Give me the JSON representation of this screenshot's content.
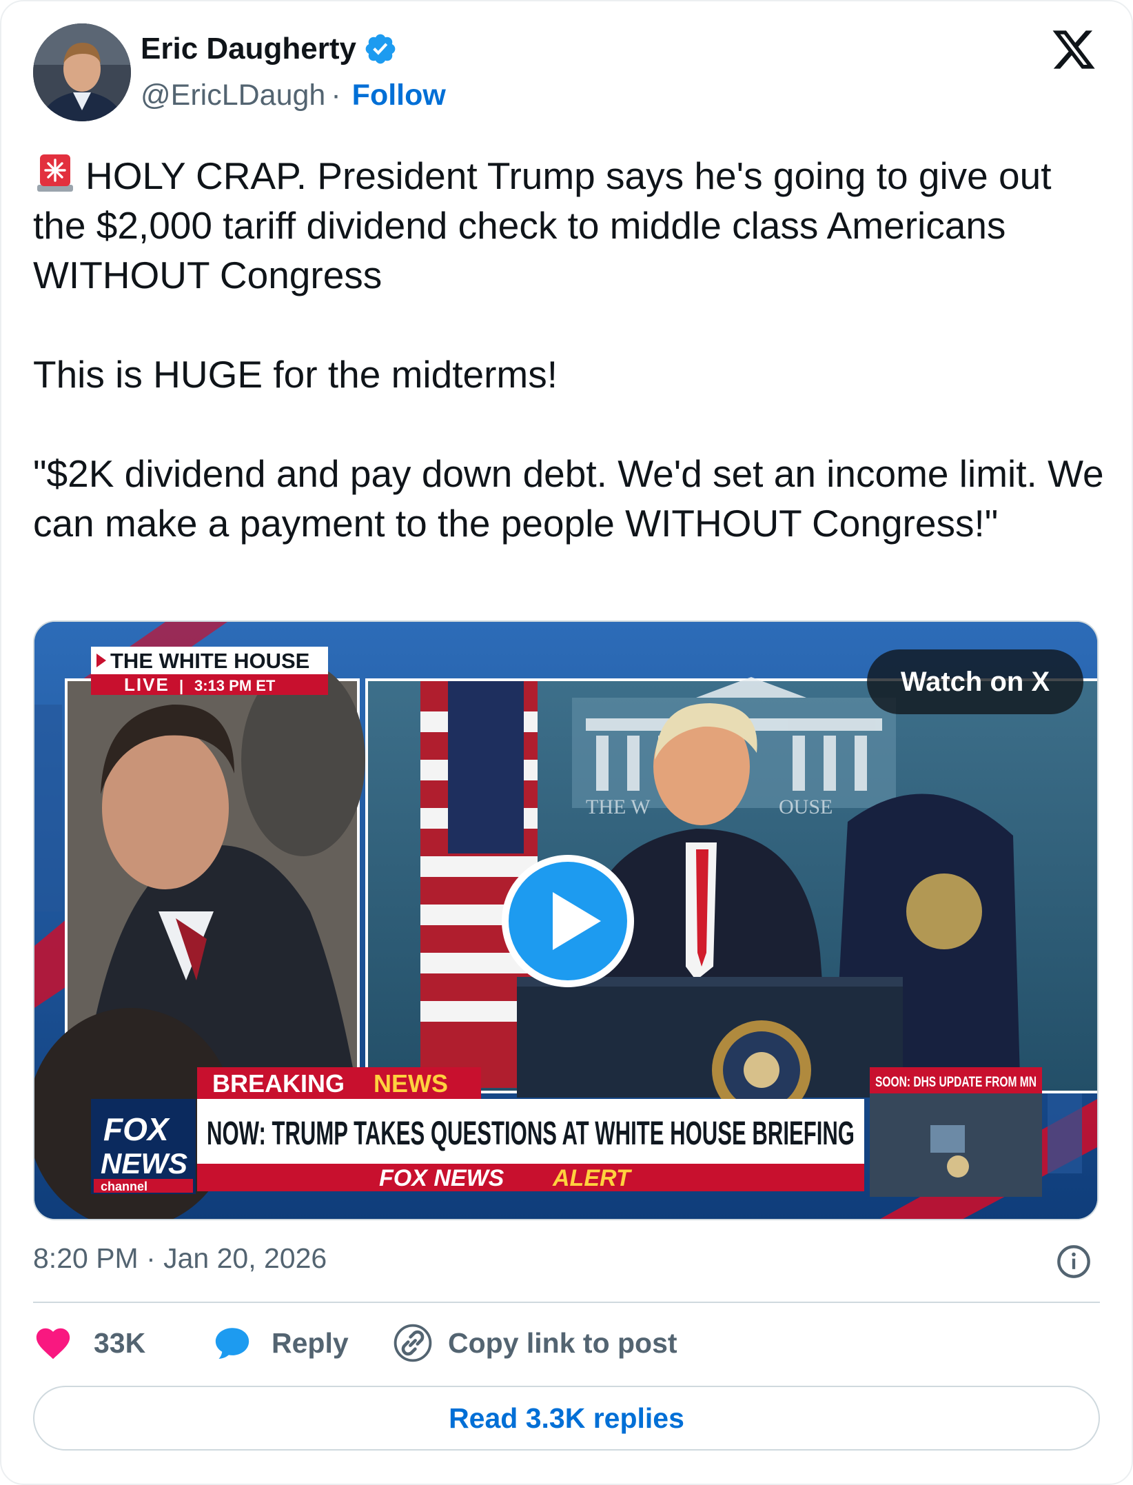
{
  "author": {
    "name": "Eric Daugherty",
    "handle": "@EricLDaugh",
    "separator": "·",
    "follow_label": "Follow",
    "verified": true
  },
  "tweet": {
    "line1_emoji": "rotating-light-emoji",
    "paragraph1": "HOLY CRAP. President Trump says he's going to give out the $2,000 tariff dividend check to middle class Americans WITHOUT Congress",
    "paragraph2": "This is HUGE for the midterms!",
    "paragraph3": "\"$2K dividend and pay down debt. We'd set an income limit. We can make a payment to the people WITHOUT Congress!\""
  },
  "media": {
    "watch_label": "Watch on X",
    "video_overlay": {
      "location_tag": "THE WHITE HOUSE",
      "live_label": "LIVE",
      "live_time": "3:13 PM ET",
      "breaking_label_1": "BREAKING",
      "breaking_label_2": "NEWS",
      "headline": "NOW: TRUMP TAKES QUESTIONS AT WHITE HOUSE BRIEFING",
      "alert_label_1": "FOX NEWS",
      "alert_label_2": "ALERT",
      "network_logo_1": "FOX",
      "network_logo_2": "NEWS",
      "network_logo_3": "channel",
      "coming_up": "SOON: DHS UPDATE FROM MN",
      "backdrop_text_left": "THE W",
      "backdrop_text_right": "OUSE"
    }
  },
  "meta": {
    "timestamp": "8:20 PM · Jan 20, 2026"
  },
  "actions": {
    "likes": "33K",
    "reply_label": "Reply",
    "copy_label": "Copy link to post",
    "read_replies_label": "Read 3.3K replies"
  },
  "colors": {
    "accent": "#006fd6",
    "like": "#f91880",
    "reply": "#1d9bf0",
    "muted": "#536471",
    "fox_red": "#c8102e"
  }
}
